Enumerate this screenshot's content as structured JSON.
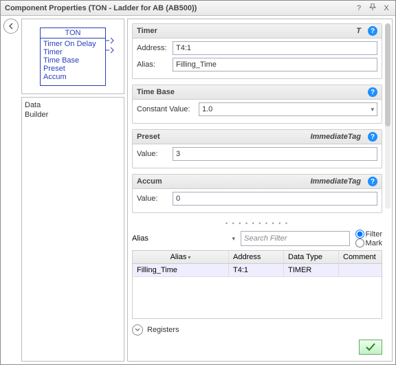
{
  "title": "Component Properties (TON - Ladder for AB (AB500))",
  "titlebar_buttons": {
    "help": "?",
    "pin": "📌",
    "close": "X"
  },
  "preview": {
    "block_title": "TON",
    "lines": [
      "Timer On Delay",
      "Timer",
      "Time Base",
      "Preset",
      "Accum"
    ]
  },
  "tree": {
    "items": [
      "Data",
      "Builder"
    ]
  },
  "sections": {
    "timer": {
      "title": "Timer",
      "tag": "T",
      "address_label": "Address:",
      "address_value": "T4:1",
      "alias_label": "Alias:",
      "alias_value": "Filling_Time"
    },
    "timebase": {
      "title": "Time Base",
      "const_label": "Constant Value:",
      "const_value": "1.0"
    },
    "preset": {
      "title": "Preset",
      "tag": "ImmediateTag",
      "value_label": "Value:",
      "value": "3"
    },
    "accum": {
      "title": "Accum",
      "tag": "ImmediateTag",
      "value_label": "Value:",
      "value": "0"
    }
  },
  "filter": {
    "mode": "Alias",
    "search_placeholder": "Search Filter",
    "radio_filter": "Filter",
    "radio_mark": "Mark"
  },
  "grid": {
    "cols": {
      "alias": "Alias",
      "address": "Address",
      "datatype": "Data Type",
      "comment": "Comment"
    },
    "row": {
      "alias": "Filling_Time",
      "address": "T4:1",
      "datatype": "TIMER",
      "comment": ""
    }
  },
  "registers_label": "Registers"
}
